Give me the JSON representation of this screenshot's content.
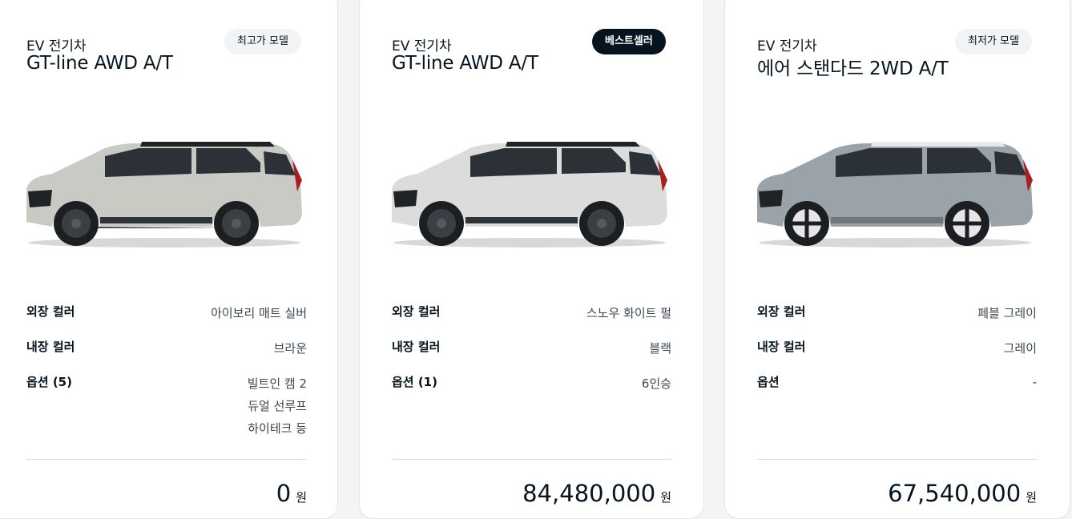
{
  "cards": [
    {
      "category": "EV 전기차",
      "model": "GT-line AWD A/T",
      "badge": "최고가 모델",
      "exterior_label": "외장 컬러",
      "exterior_value": "아이보리 매트 실버",
      "interior_label": "내장 컬러",
      "interior_value": "브라운",
      "options_label": "옵션 (5)",
      "options_values": [
        "빌트인 캠 2",
        "듀얼 선루프",
        "하이테크 등"
      ],
      "price": "0",
      "price_unit": "원",
      "car_color": "#c9cac3"
    },
    {
      "category": "EV 전기차",
      "model": "GT-line AWD A/T",
      "badge": "베스트셀러",
      "exterior_label": "외장 컬러",
      "exterior_value": "스노우 화이트 펄",
      "interior_label": "내장 컬러",
      "interior_value": "블랙",
      "options_label": "옵션 (1)",
      "options_values": [
        "6인승"
      ],
      "price": "84,480,000",
      "price_unit": "원",
      "car_color": "#dcdcdc"
    },
    {
      "category": "EV 전기차",
      "model": "에어 스탠다드 2WD A/T",
      "badge": "최저가 모델",
      "exterior_label": "외장 컬러",
      "exterior_value": "페블 그레이",
      "interior_label": "내장 컬러",
      "interior_value": "그레이",
      "options_label": "옵션",
      "options_values": [
        "-"
      ],
      "price": "67,540,000",
      "price_unit": "원",
      "car_color": "#9aa2aa"
    }
  ]
}
